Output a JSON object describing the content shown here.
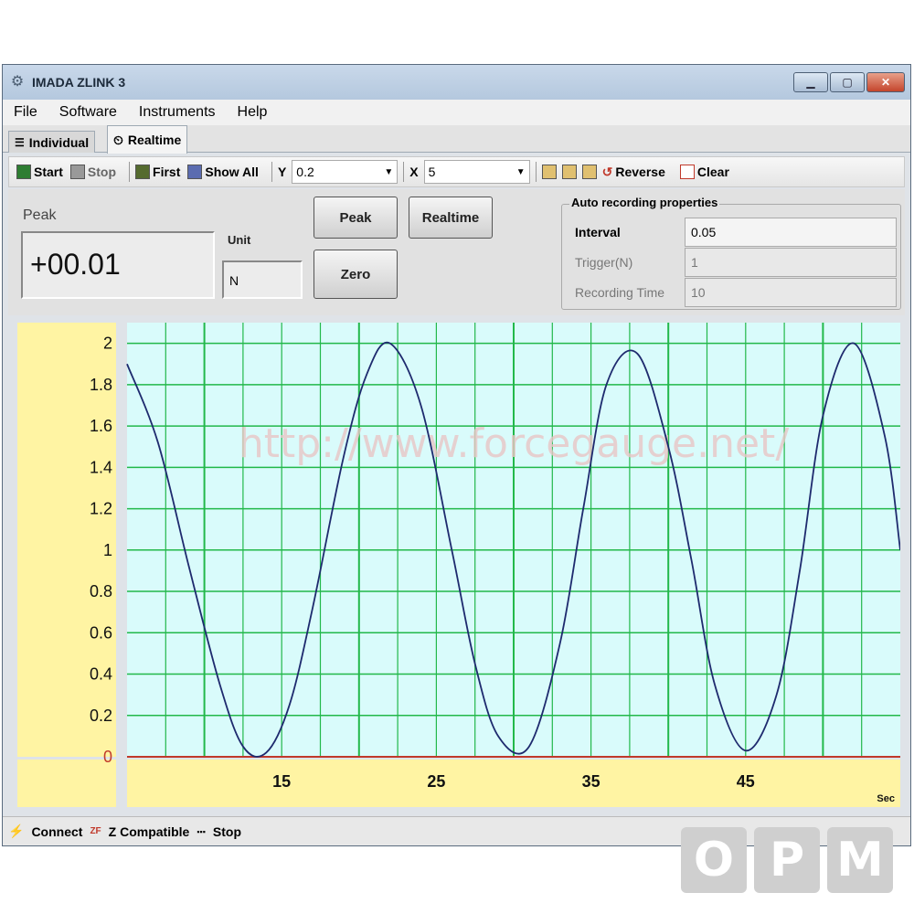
{
  "window": {
    "title": "IMADA ZLINK 3"
  },
  "menu": [
    "File",
    "Software",
    "Instruments",
    "Help"
  ],
  "tabs": [
    {
      "label": "Individual"
    },
    {
      "label": "Realtime"
    }
  ],
  "toolbar": {
    "start": "Start",
    "stop": "Stop",
    "first": "First",
    "show_all": "Show All",
    "y_label": "Y",
    "y_value": "0.2",
    "x_label": "X",
    "x_value": "5",
    "reverse": "Reverse",
    "clear": "Clear"
  },
  "panel": {
    "peak_label": "Peak",
    "peak_value": "+00.01",
    "unit_label": "Unit",
    "unit_value": "N",
    "btn_peak": "Peak",
    "btn_realtime": "Realtime",
    "btn_zero": "Zero",
    "auto": {
      "title": "Auto recording properties",
      "interval_label": "Interval",
      "interval_value": "0.05",
      "trigger_label": "Trigger(N)",
      "trigger_value": "1",
      "rectime_label": "Recording Time",
      "rectime_value": "10"
    }
  },
  "chart_data": {
    "type": "line",
    "ylim": [
      0,
      2.1
    ],
    "xlim": [
      5,
      55
    ],
    "yticks": [
      "2",
      "1.8",
      "1.6",
      "1.4",
      "1.2",
      "1",
      "0.8",
      "0.6",
      "0.4",
      "0.2",
      "0"
    ],
    "xticks": [
      "15",
      "25",
      "35",
      "45"
    ],
    "xunit": "Sec",
    "watermark": "http://www.forcegauge.net/",
    "series": [
      {
        "x": [
          5,
          7,
          9,
          11,
          12.5,
          14,
          15.5,
          17,
          19,
          20.5,
          22,
          24,
          26,
          27.5,
          29,
          31,
          33,
          34.5,
          36,
          38,
          40,
          41.5,
          43,
          45,
          47,
          48.5,
          50,
          52,
          54,
          55
        ],
        "y": [
          1.9,
          1.52,
          0.92,
          0.35,
          0.05,
          0.02,
          0.25,
          0.72,
          1.45,
          1.85,
          2.0,
          1.7,
          1.0,
          0.45,
          0.1,
          0.05,
          0.55,
          1.2,
          1.8,
          1.95,
          1.5,
          0.95,
          0.35,
          0.03,
          0.3,
          0.9,
          1.65,
          2.0,
          1.55,
          1.0
        ],
        "color": "#1e2a6e"
      }
    ],
    "zero_line_color": "#c0392b",
    "grid_color": "#22b84a",
    "plot_bg": "#d9fbfb",
    "axis_bg": "#fff4a3"
  },
  "status": {
    "connect": "Connect",
    "zf_icon": "ZF",
    "compatible": "Z Compatible",
    "stop": "Stop"
  },
  "watermark_logo": [
    "O",
    "P",
    "M"
  ]
}
